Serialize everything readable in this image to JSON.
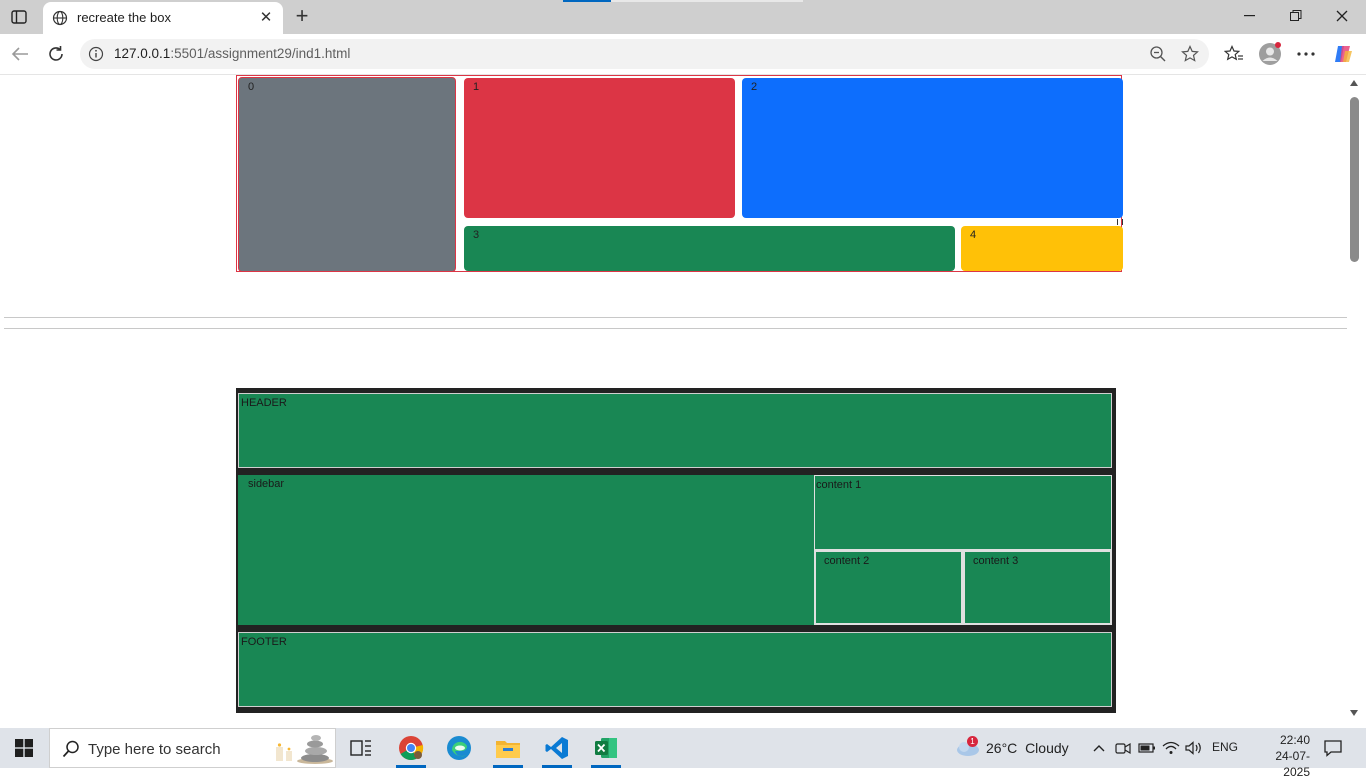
{
  "browser": {
    "tab_title": "recreate the box",
    "new_tab_symbol": "+",
    "address": {
      "host": "127.0.0.1",
      "path": ":5501/assignment29/ind1.html"
    }
  },
  "page": {
    "flex_boxes": [
      {
        "label": "0",
        "color": "#6c757d"
      },
      {
        "label": "1",
        "color": "#dc3545"
      },
      {
        "label": "2",
        "color": "#0d6efd"
      },
      {
        "label": "3",
        "color": "#198754"
      },
      {
        "label": "4",
        "color": "#ffc107"
      }
    ],
    "grid": {
      "header": "HEADER",
      "sidebar": "sidebar",
      "content1": "content 1",
      "content2": "content 2",
      "content3": "content 3",
      "footer": "FOOTER"
    }
  },
  "taskbar": {
    "search_placeholder": "Type here to search",
    "weather": {
      "temp": "26°C",
      "condition": "Cloudy",
      "badge": "1"
    },
    "language": "ENG",
    "time": "22:40",
    "date": "24-07-2025"
  },
  "colors": {
    "accent": "#0067c0",
    "grid_green": "#198754",
    "border_red": "#dc3545"
  }
}
